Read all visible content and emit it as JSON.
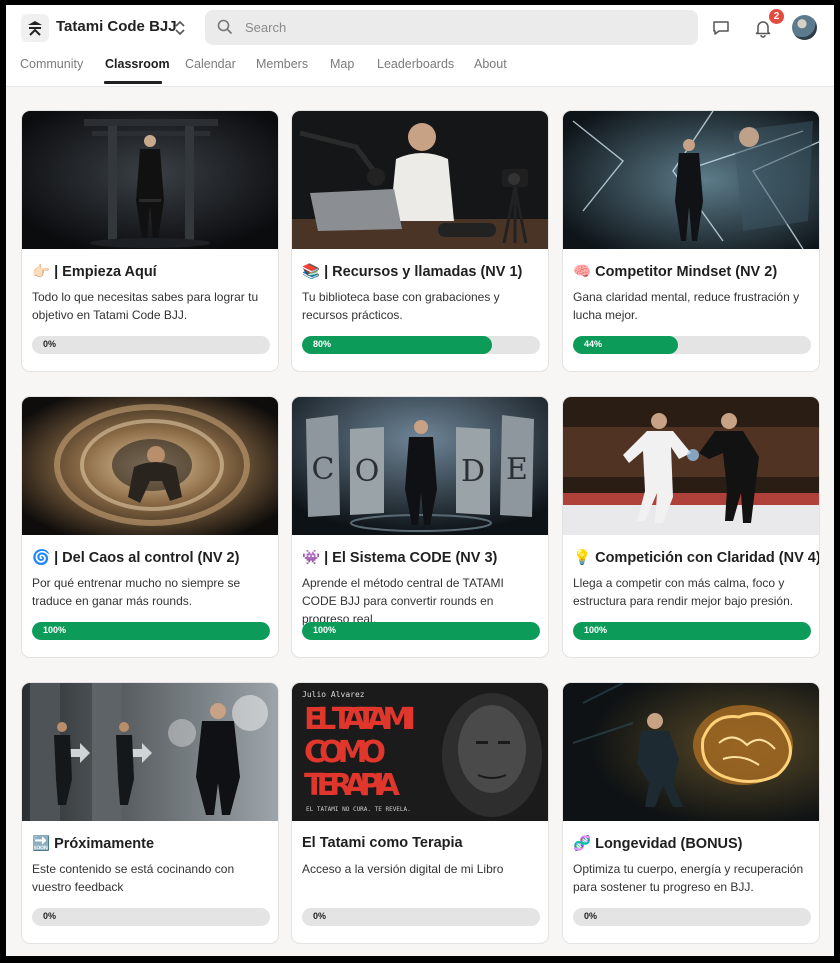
{
  "app": {
    "name": "Tatami Code BJJ"
  },
  "search": {
    "placeholder": "Search"
  },
  "notifications": {
    "count": "2"
  },
  "nav": {
    "tabs": [
      "Community",
      "Classroom",
      "Calendar",
      "Members",
      "Map",
      "Leaderboards",
      "About"
    ],
    "active": "Classroom"
  },
  "colors": {
    "progress_fill": "#0d9b5a",
    "progress_track": "#e4e4e4",
    "badge": "#e34b3f"
  },
  "courses": [
    {
      "emoji": "👉🏻",
      "title": "| Empieza Aquí",
      "description": "Todo lo que necesitas sabes para lograr tu objetivo en Tatami Code BJJ.",
      "progress_label": "0%",
      "progress": 0
    },
    {
      "emoji": "📚",
      "title": "| Recursos y llamadas (NV 1)",
      "description": "Tu biblioteca base con grabaciones y recursos prácticos.",
      "progress_label": "80%",
      "progress": 0.8
    },
    {
      "emoji": "🧠",
      "title": "Competitor Mindset (NV 2)",
      "description": "Gana claridad mental, reduce frustración y lucha mejor.",
      "progress_label": "44%",
      "progress": 0.44
    },
    {
      "emoji": "🌀",
      "title": "| Del Caos al control (NV 2)",
      "description": "Por qué entrenar mucho no siempre se traduce en ganar más rounds.",
      "progress_label": "100%",
      "progress": 1
    },
    {
      "emoji": "👾",
      "title": "| El Sistema CODE (NV 3)",
      "description": "Aprende el método central de TATAMI CODE BJJ para convertir rounds en progreso real.",
      "progress_label": "100%",
      "progress": 1
    },
    {
      "emoji": "💡",
      "title": "Competición con Claridad (NV 4)",
      "description": "Llega a competir con más calma, foco y estructura para rendir mejor bajo presión.",
      "progress_label": "100%",
      "progress": 1
    },
    {
      "emoji": "🔜",
      "title": "Próximamente",
      "description": "Este contenido se está cocinando con vuestro feedback",
      "progress_label": "0%",
      "progress": 0
    },
    {
      "emoji": "",
      "title": "El Tatami como Terapia",
      "description": "Acceso a la versión digital de mi Libro",
      "progress_label": "0%",
      "progress": 0
    },
    {
      "emoji": "🧬",
      "title": "Longevidad (BONUS)",
      "description": "Optimiza tu cuerpo, energía y recuperación para sostener tu progreso en BJJ.",
      "progress_label": "0%",
      "progress": 0
    }
  ],
  "book_cover": {
    "author": "Julio Alvarez",
    "title": "EL TATAMI COMO TERAPIA",
    "tagline": "EL TATAMI NO CURA. TE REVELA."
  },
  "code_letters": [
    "C",
    "O",
    "D",
    "E"
  ]
}
